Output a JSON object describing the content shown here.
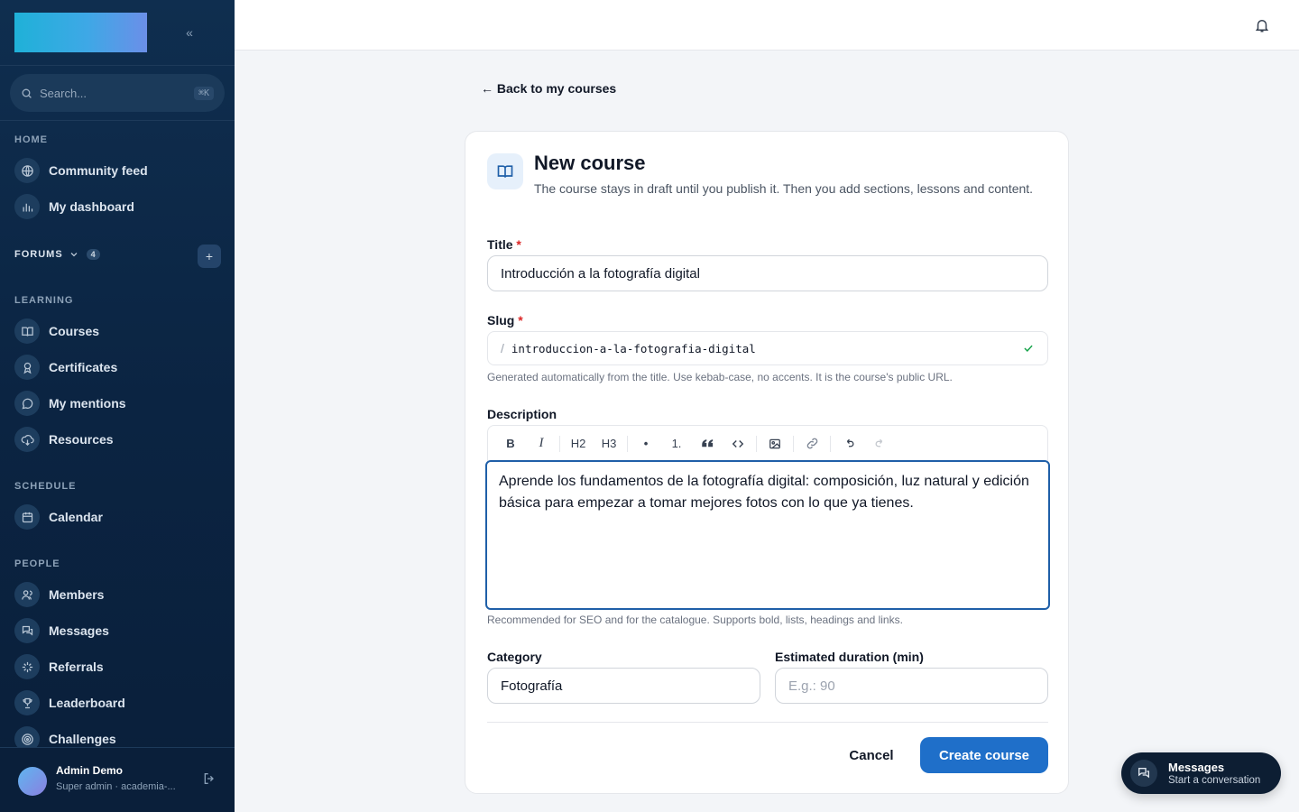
{
  "sidebar": {
    "search_placeholder": "Search...",
    "search_shortcut": "⌘K",
    "sections": {
      "home": "HOME",
      "forums": "FORUMS",
      "forums_count": "4",
      "learning": "LEARNING",
      "schedule": "SCHEDULE",
      "people": "PEOPLE"
    },
    "items": {
      "community_feed": "Community feed",
      "my_dashboard": "My dashboard",
      "courses": "Courses",
      "certificates": "Certificates",
      "my_mentions": "My mentions",
      "resources": "Resources",
      "calendar": "Calendar",
      "members": "Members",
      "messages": "Messages",
      "referrals": "Referrals",
      "leaderboard": "Leaderboard",
      "challenges": "Challenges"
    },
    "user": {
      "name": "Admin Demo",
      "role": "Super admin · academia-..."
    }
  },
  "main": {
    "back_link": "← Back to my courses",
    "card": {
      "title": "New course",
      "subtitle": "The course stays in draft until you publish it. Then you add sections, lessons and content."
    },
    "form": {
      "title_label": "Title",
      "title_value": "Introducción a la fotografía digital",
      "slug_label": "Slug",
      "slug_prefix": "/",
      "slug_value": "introduccion-a-la-fotografia-digital",
      "slug_help": "Generated automatically from the title. Use kebab-case, no accents. It is the course's public URL.",
      "description_label": "Description",
      "toolbar": {
        "bold": "B",
        "italic": "I",
        "h2": "H2",
        "h3": "H3",
        "bullet": "•",
        "ordered": "1."
      },
      "description_value": "Aprende los fundamentos de la fotografía digital: composición, luz natural y edición básica para empezar a tomar mejores fotos con lo que ya tienes.",
      "description_help": "Recommended for SEO and for the catalogue. Supports bold, lists, headings and links.",
      "category_label": "Category",
      "category_value": "Fotografía",
      "duration_label": "Estimated duration (min)",
      "duration_placeholder": "E.g.: 90",
      "cancel": "Cancel",
      "create": "Create course",
      "required_mark": "*"
    }
  },
  "messages_widget": {
    "title": "Messages",
    "subtitle": "Start a conversation"
  },
  "colors": {
    "primary": "#1f6fc9",
    "sidebar_bg": "#0b2442",
    "focus_border": "#1f5fa8",
    "required": "#dc2626"
  }
}
